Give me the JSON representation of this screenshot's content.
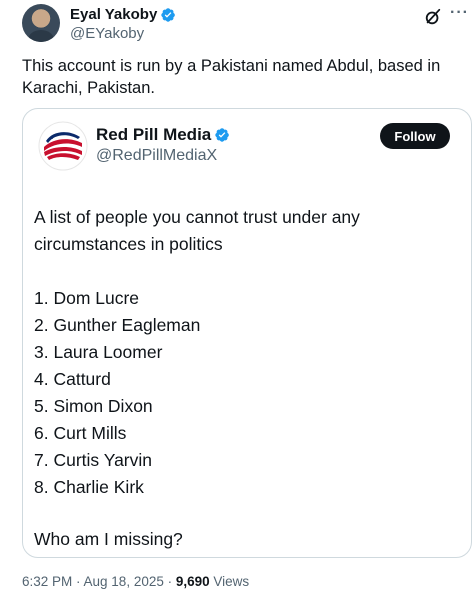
{
  "tweet": {
    "author_name": "Eyal Yakoby",
    "author_handle": "@EYakoby",
    "text": "This account is run by a Pakistani named Abdul, based in Karachi, Pakistan.",
    "more_label": "···",
    "time": "6:32 PM · Aug 18, 2025 · ",
    "views_count": "9,690",
    "views_label": " Views"
  },
  "quoted": {
    "author_name": "Red Pill Media",
    "author_handle": "@RedPillMediaX",
    "follow_label": "Follow",
    "intro": "A list of people you cannot trust under any circumstances in politics",
    "list": [
      "1. Dom Lucre",
      "2. Gunther Eagleman",
      "3. Laura Loomer",
      "4. Catturd",
      "5. Simon Dixon",
      "6. Curt Mills",
      "7. Curtis Yarvin",
      "8. Charlie Kirk"
    ],
    "outro": "Who am I missing?"
  },
  "colors": {
    "verified_blue": "#1d9bf0",
    "text": "#0f1419",
    "secondary_text": "#536471",
    "border": "#cfd9de"
  },
  "icons": {
    "verified": "verified-badge-icon",
    "grok": "grok-icon",
    "more": "more-icon"
  }
}
